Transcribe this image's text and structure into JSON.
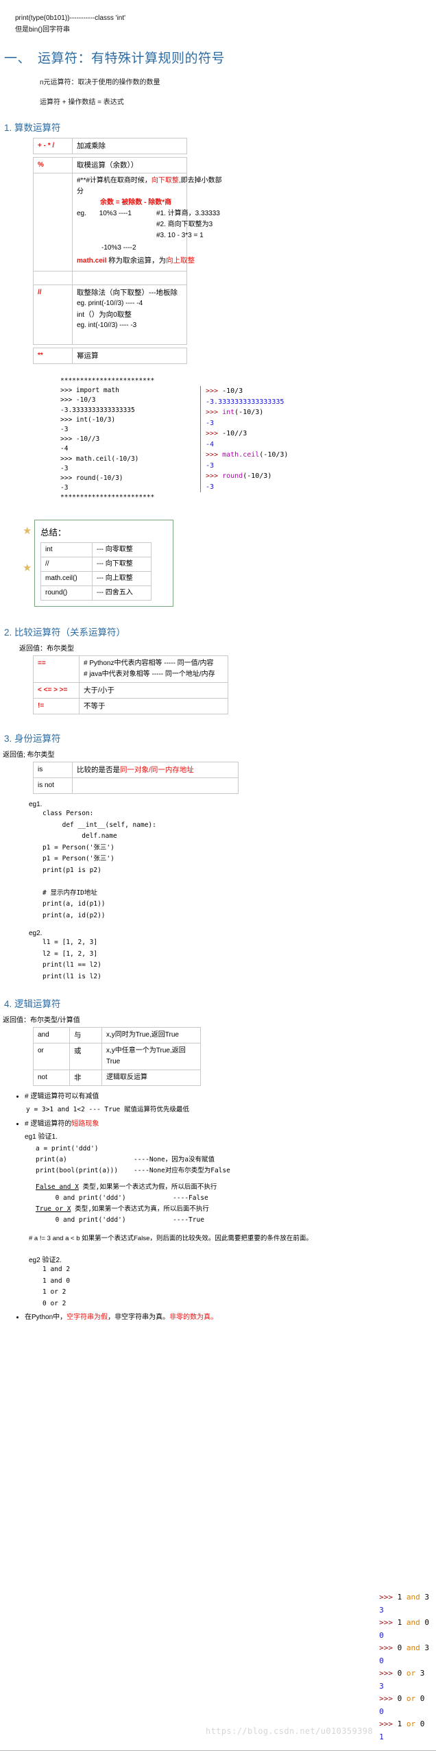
{
  "intro": {
    "line1": "print(type(0b101))-----------classs 'int'",
    "line2": "但是bin()回字符串"
  },
  "heading": {
    "num": "一、",
    "text": "运算符：有特殊计算规则的符号"
  },
  "notes": {
    "nary": "n元运算符：取决于使用的操作数的数量",
    "expr": "运算符 + 操作数结 = 表达式"
  },
  "section1": {
    "title": "1. 算数运算符",
    "rows": {
      "r1_sym": "+ - * /",
      "r1_desc": "加减乘除",
      "r2_sym": "%",
      "r2_desc": "取模运算（余数））",
      "r3_line1_a": "#**#计算机在取商时候，",
      "r3_line1_hl": "向下取整",
      "r3_line1_b": ",即去掉小数部分",
      "r3_line2": "余数 = 被除数 - 除数*商",
      "r3_eg_label": "eg.",
      "r3_eg1": "10%3  ----1",
      "r3_note1": "#1. 计算商，3.33333",
      "r3_note2": "#2. 商向下取整为3",
      "r3_note3": "#3. 10 - 3*3 = 1",
      "r3_eg2": "-10%3 ----2",
      "r3_ceil_name": "math.ceil",
      "r3_ceil_text": "称为取余运算，为",
      "r3_ceil_hl": "向上取整",
      "r4_sym": "//",
      "r4_line1": "取整除法（向下取整）---地板除",
      "r4_line2": "eg. print(-10//3)  ---- -4",
      "r4_line3": "int（）为向0取整",
      "r4_line4": "eg. int(-10//3)      ---- -3",
      "r5_sym": "**",
      "r5_desc": "幂运算"
    }
  },
  "console1": {
    "left": [
      "************************",
      ">>> import math",
      ">>> -10/3",
      "-3.3333333333333335",
      ">>> int(-10/3)",
      "-3",
      ">>> -10//3",
      "-4",
      ">>> math.ceil(-10/3)",
      "-3",
      ">>> round(-10/3)",
      "-3",
      "************************"
    ],
    "right": [
      {
        "prompt": ">>> ",
        "code": "-10/3",
        "kw": ""
      },
      {
        "out": "-3.3333333333333335"
      },
      {
        "prompt": ">>> ",
        "kw": "int",
        "code": "(-10/3)"
      },
      {
        "out": "-3"
      },
      {
        "prompt": ">>> ",
        "code": "-10//3",
        "kw": ""
      },
      {
        "out": "-4"
      },
      {
        "prompt": ">>> ",
        "kw": "math.ceil",
        "code": "(-10/3)"
      },
      {
        "out": "-3"
      },
      {
        "prompt": ">>> ",
        "kw": "round",
        "code": "(-10/3)"
      },
      {
        "out": "-3"
      }
    ]
  },
  "summary": {
    "title": "总结：",
    "rows": [
      {
        "name": "int",
        "desc": "--- 向零取整"
      },
      {
        "name": "//",
        "desc": "---       向下取整"
      },
      {
        "name": "math.ceil()",
        "desc": "--- 向上取整"
      },
      {
        "name": "round()",
        "desc": "--- 四舍五入"
      }
    ],
    "star": "★"
  },
  "section2": {
    "title": "2. 比较运算符（关系运算符）",
    "note": "返回值：布尔类型",
    "rows": {
      "r1_sym": "==",
      "r1_l1": "# Pythonz中代表内容相等  -----  同一值/内容",
      "r1_l2": "# java中代表对象相等      -----  同一个地址/内存",
      "r2_sym": "< <= > >=",
      "r2_desc": "大于/小于",
      "r3_sym": "!=",
      "r3_desc": "不等于"
    }
  },
  "section3": {
    "title": "3. 身份运算符",
    "note": "返回值; 布尔类型",
    "rows": {
      "r1_sym": "is",
      "r1_desc_a": "比较的是否是",
      "r1_desc_hl": "同一对象/同一内存地址",
      "r2_sym": "is not",
      "r2_desc": ""
    },
    "eg1_label": "eg1.",
    "eg1_code": "class Person:\n     def __int__(self, name):\n          delf.name\np1 = Person('张三')\np1 = Person('张三')\nprint(p1 is p2)\n\n# 显示内存ID地址\nprint(a, id(p1))\nprint(a, id(p2))",
    "eg2_label": "eg2.",
    "eg2_code": "l1 = [1, 2, 3]\nl2 = [1, 2, 3]\nprint(l1 == l2)\nprint(l1 is l2)"
  },
  "section4": {
    "title": "4. 逻辑运算符",
    "note": "返回值：布尔类型/计算值",
    "rows": [
      {
        "sym": "and",
        "cn": "与",
        "desc": "x,y同时为True,返回True"
      },
      {
        "sym": "or",
        "cn": "或",
        "desc": "x,y中任意一个为True,返回True"
      },
      {
        "sym": "not",
        "cn": "非",
        "desc": "逻辑取反运算"
      }
    ],
    "bullets": {
      "b1": "# 逻辑运算符可以有减值",
      "b1_sub": "y = 3>1 and 1<2   ---  True      赋值运算符优先级最低",
      "b2_a": "# 逻辑运算符的",
      "b2_hl": "短路现象",
      "eg1_label": "eg1 验证1.",
      "eg1_code": "a = print('ddd')\nprint(a)                 ----None，因为a没有赋值\nprint(bool(print(a)))    ----None对应布尔类型为False",
      "eg1_note1_u": "False and X",
      "eg1_note1": " 类型,如果第一个表达式为假，所以后面不执行",
      "eg1_note1b": "     0 and print('ddd')            ----False",
      "eg1_note2_u": "True or X",
      "eg1_note2": " 类型,如果第一个表达式为真，所以后面不执行",
      "eg1_note2b": "     0 and print('ddd')            ----True"
    },
    "para": "# a != 3 and a < b 如果第一个表达式False，则后面的比较失效。因此需要把重要的条件放在前面。",
    "eg2_label": "eg2 验证2.",
    "eg2_code": "1 and 2\n1 and 0\n1 or 2\n0 or 2",
    "bullet_final_a": "在Python中，",
    "bullet_final_hl1": "空字符串为假",
    "bullet_final_b": "，非空字符串为真。",
    "bullet_final_hl2": "非零的数为真。"
  },
  "console2": {
    "lines": [
      {
        "prompt": ">>> ",
        "a": "1 ",
        "op": "and",
        "b": " 3"
      },
      {
        "out": "3"
      },
      {
        "prompt": ">>> ",
        "a": "1 ",
        "op": "and",
        "b": " 0"
      },
      {
        "out": "0"
      },
      {
        "prompt": ">>> ",
        "a": "0 ",
        "op": "and",
        "b": " 3"
      },
      {
        "out": "0"
      },
      {
        "prompt": ">>> ",
        "a": "0 ",
        "op": "or",
        "b": " 3"
      },
      {
        "out": "3"
      },
      {
        "prompt": ">>> ",
        "a": "0 ",
        "op": "or",
        "b": " 0"
      },
      {
        "out": "0"
      },
      {
        "prompt": ">>> ",
        "a": "1 ",
        "op": "or",
        "b": " 0"
      },
      {
        "out": "1"
      }
    ]
  },
  "watermark": "https://blog.csdn.net/u010359398",
  "colors": {
    "heading_blue": "#2e6da4",
    "red": "#e8130f",
    "prompt_red": "#a01010",
    "value_blue": "#1414d8",
    "keyword_magenta": "#b000b0",
    "keyword_orange": "#e08000",
    "box_green": "#79a87e",
    "star_gold": "#e0bc64"
  }
}
